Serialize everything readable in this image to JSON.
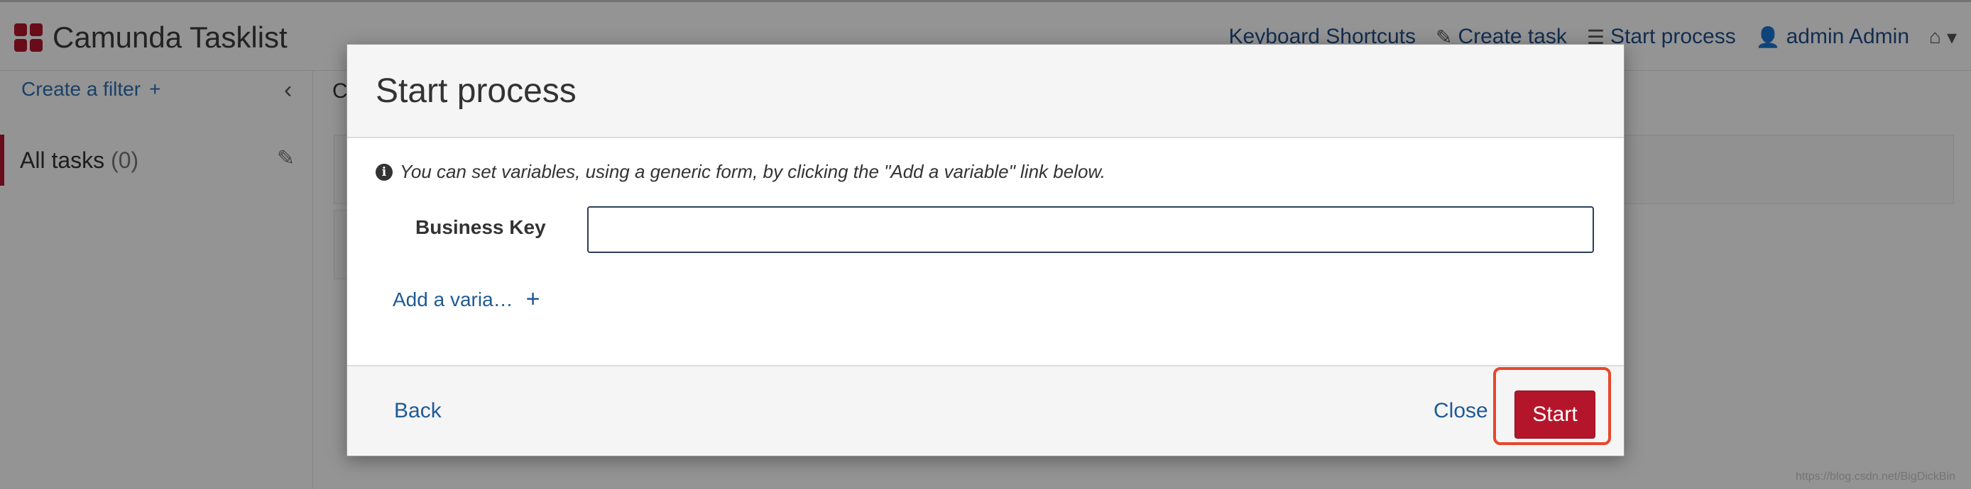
{
  "app": {
    "title": "Camunda Tasklist",
    "nav": {
      "keyboard_shortcuts": "Keyboard Shortcuts",
      "create_task": "Create task",
      "start_process": "Start process",
      "user": "admin Admin"
    },
    "sidebar": {
      "create_filter": "Create a filter",
      "filters": [
        {
          "label": "All tasks",
          "count": "(0)"
        }
      ]
    },
    "watermark": "https://blog.csdn.net/BigDickBin"
  },
  "modal": {
    "title": "Start process",
    "hint": "You can set variables, using a generic form, by clicking the \"Add a variable\" link below.",
    "business_key": {
      "label": "Business Key",
      "value": "",
      "placeholder": ""
    },
    "add_variable": "Add a varia…",
    "footer": {
      "back": "Back",
      "close": "Close",
      "start": "Start"
    }
  },
  "colors": {
    "brand": "#b5152b",
    "link": "#1f5a96",
    "highlight": "#e8472a"
  }
}
